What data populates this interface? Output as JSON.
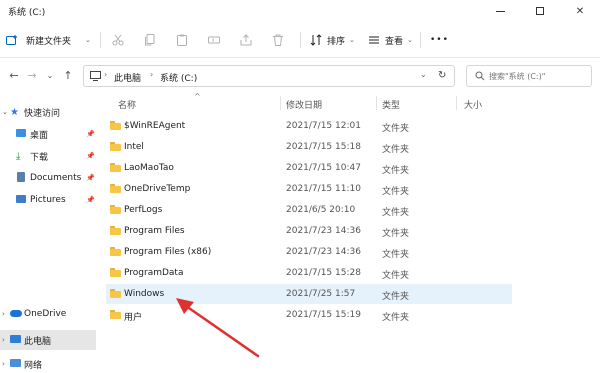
{
  "window": {
    "title": "系统 (C:)"
  },
  "toolbar": {
    "new_label": "新建文件夹",
    "sort_label": "排序",
    "view_label": "查看",
    "more": "•••"
  },
  "address": {
    "path": [
      "此电脑",
      "系统 (C:)"
    ],
    "search_placeholder": "搜索\"系统 (C:)\""
  },
  "sidebar": {
    "items": [
      {
        "label": "快速访问",
        "icon": "star-icon"
      },
      {
        "label": "桌面",
        "icon": "desktop-icon"
      },
      {
        "label": "下载",
        "icon": "download-icon"
      },
      {
        "label": "Documents",
        "icon": "document-icon"
      },
      {
        "label": "Pictures",
        "icon": "picture-icon"
      },
      {
        "label": "OneDrive",
        "icon": "cloud-icon"
      },
      {
        "label": "此电脑",
        "icon": "computer-icon"
      },
      {
        "label": "网络",
        "icon": "network-icon"
      }
    ]
  },
  "columns": {
    "name": "名称",
    "date": "修改日期",
    "type": "类型",
    "size": "大小"
  },
  "files": [
    {
      "name": "$WinREAgent",
      "date": "2021/7/15 12:01",
      "type": "文件夹"
    },
    {
      "name": "Intel",
      "date": "2021/7/15 15:18",
      "type": "文件夹"
    },
    {
      "name": "LaoMaoTao",
      "date": "2021/7/15 10:47",
      "type": "文件夹"
    },
    {
      "name": "OneDriveTemp",
      "date": "2021/7/15 11:10",
      "type": "文件夹"
    },
    {
      "name": "PerfLogs",
      "date": "2021/6/5 20:10",
      "type": "文件夹"
    },
    {
      "name": "Program Files",
      "date": "2021/7/23 14:36",
      "type": "文件夹"
    },
    {
      "name": "Program Files (x86)",
      "date": "2021/7/23 14:36",
      "type": "文件夹"
    },
    {
      "name": "ProgramData",
      "date": "2021/7/15 15:28",
      "type": "文件夹"
    },
    {
      "name": "Windows",
      "date": "2021/7/25 1:57",
      "type": "文件夹"
    },
    {
      "name": "用户",
      "date": "2021/7/15 15:19",
      "type": "文件夹"
    }
  ],
  "colors": {
    "accent": "#0067c0",
    "selection": "#e5f1fb",
    "folder": "#f7c648",
    "arrow": "#e03131"
  }
}
